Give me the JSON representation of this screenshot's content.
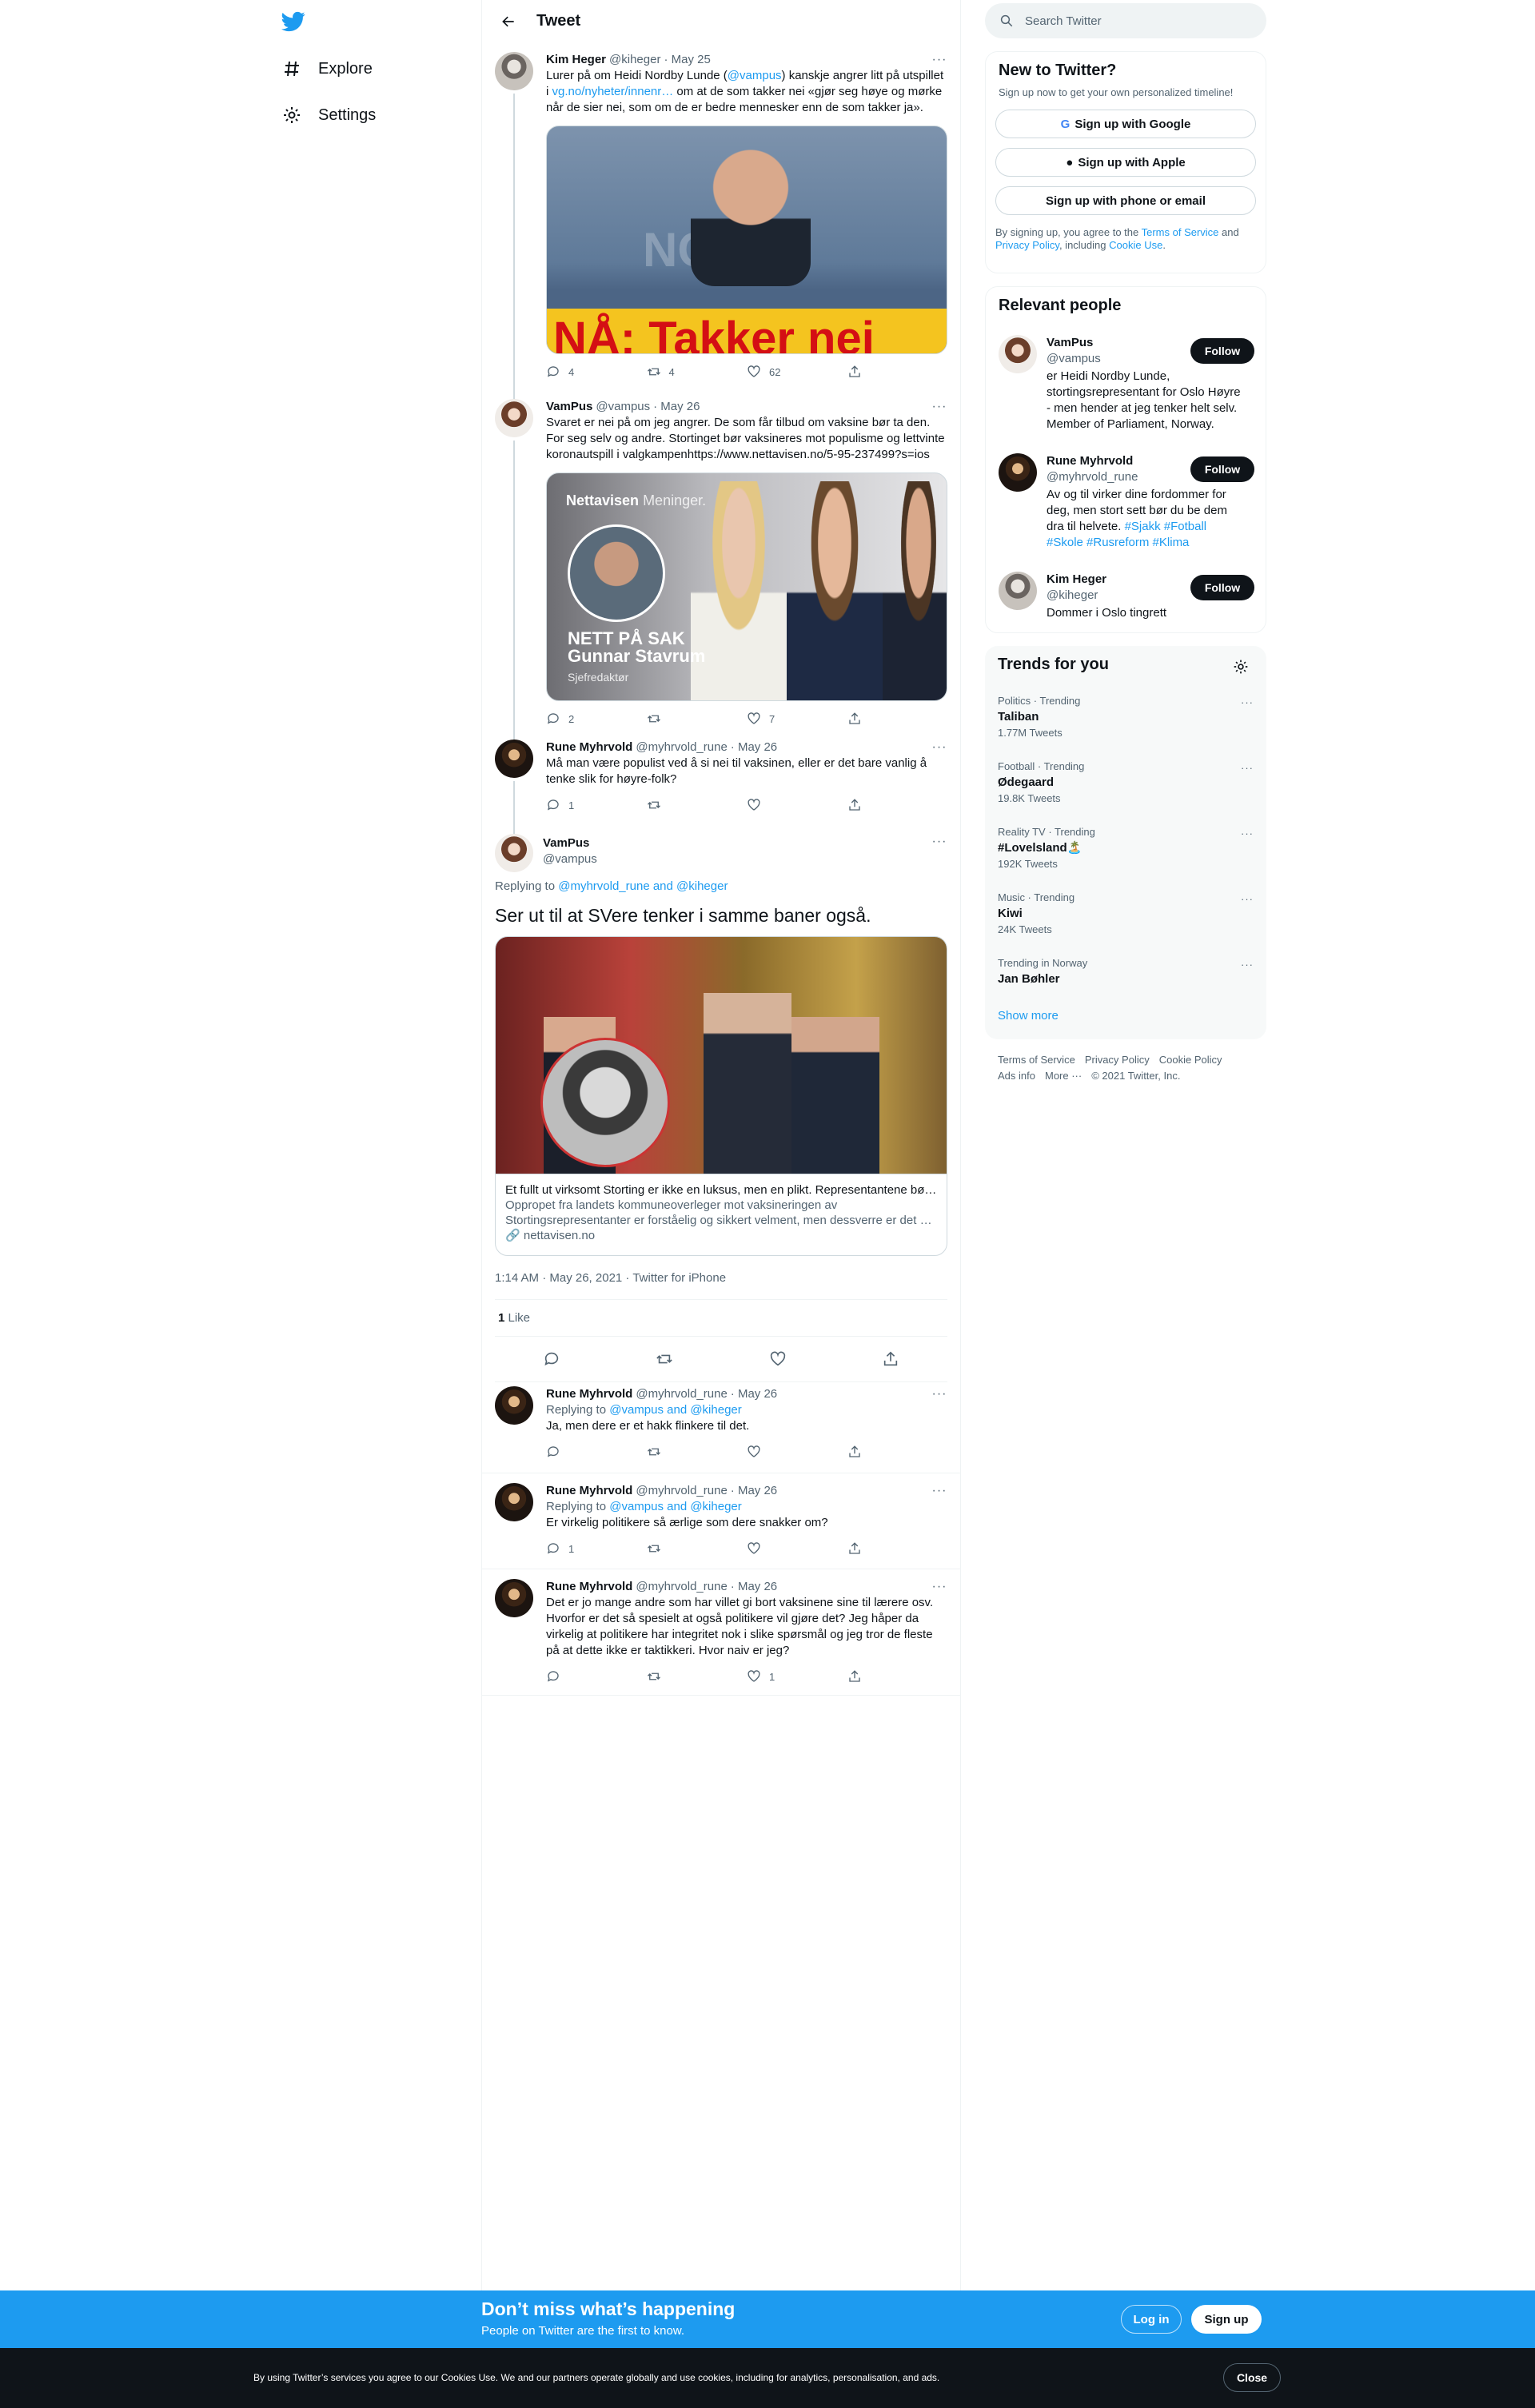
{
  "nav": {
    "explore": "Explore",
    "settings": "Settings"
  },
  "header": {
    "title": "Tweet"
  },
  "tweets": [
    {
      "name": "Kim Heger",
      "handle": "@kiheger",
      "date": "· May 25",
      "t1": "Lurer på om Heidi Nordby Lunde (",
      "mention": "@vampus",
      "t2": ") kanskje angrer litt på utspillet i ",
      "link": "vg.no/nyheter/innenr…",
      "t3": " om at de som takker nei «gjør seg høye og mørke når de sier nei, som om de er bedre mennesker enn de som takker ja».",
      "image_caption": "NÅ: Takker nei",
      "image_bg_text": "NO",
      "replies": "4",
      "retweets": "4",
      "likes": "62"
    },
    {
      "name": "VamPus",
      "handle": "@vampus",
      "date": "· May 26",
      "text": "Svaret er nei på om jeg angrer. De som får tilbud om vaksine bør ta den. For seg selv og andre. Stortinget bør vaksineres mot populisme og lettvinte koronautspill i valgkampenhttps://www.nettavisen.no/5-95-237499?s=ios",
      "card_brand": "Nettavisen",
      "card_brand2": "Meninger.",
      "card_line1": "NETT PÅ SAK",
      "card_line2": "Gunnar Stavrum",
      "card_line3": "Sjefredaktør",
      "replies": "2",
      "retweets": "",
      "likes": "7"
    },
    {
      "name": "Rune Myhrvold",
      "handle": "@myhrvold_rune",
      "date": "· May 26",
      "text": "Må man være populist ved å si nei til vaksinen, eller er det bare vanlig å tenke slik for høyre-folk?",
      "replies": "1",
      "retweets": "",
      "likes": ""
    }
  ],
  "main": {
    "name": "VamPus",
    "handle": "@vampus",
    "replying_prefix": "Replying to ",
    "replying_to": "@myhrvold_rune and @kiheger",
    "text": "Ser ut til at SVere tenker i samme baner også.",
    "card_title": "Et fullt ut virksomt Storting er ikke en luksus, men en plikt. Representantene bør…",
    "card_desc": "Oppropet fra landets kommuneoverleger mot vaksineringen av Stortingsrepresentanter er forståelig og sikkert velment, men dessverre er det …",
    "card_domain": "nettavisen.no",
    "timestamp": "1:14 AM · May 26, 2021 · Twitter for iPhone",
    "likes_count": "1",
    "likes_label": " Like"
  },
  "replies": [
    {
      "name": "Rune Myhrvold",
      "handle": "@myhrvold_rune",
      "date": "· May 26",
      "replying_prefix": "Replying to ",
      "replying_to": "@vampus and @kiheger",
      "text": "Ja, men dere er et hakk flinkere til det.",
      "replies": "",
      "likes": ""
    },
    {
      "name": "Rune Myhrvold",
      "handle": "@myhrvold_rune",
      "date": "· May 26",
      "replying_prefix": "Replying to ",
      "replying_to": "@vampus and @kiheger",
      "text": "Er virkelig politikere så ærlige som dere snakker om?",
      "replies": "1",
      "likes": ""
    },
    {
      "name": "Rune Myhrvold",
      "handle": "@myhrvold_rune",
      "date": "· May 26",
      "text": "Det er jo mange andre som har villet gi bort vaksinene sine til lærere osv. Hvorfor er det så spesielt at også politikere vil gjøre det? Jeg håper da virkelig at politikere har integritet nok i slike spørsmål og jeg tror de fleste på at dette ikke er taktikkeri. Hvor naiv er jeg?",
      "replies": "",
      "likes": "1"
    }
  ],
  "search": {
    "placeholder": "Search Twitter"
  },
  "new_to_twitter": {
    "title": "New to Twitter?",
    "subtitle": "Sign up now to get your own personalized timeline!",
    "google": "Sign up with Google",
    "apple": "Sign up with Apple",
    "phone": "Sign up with phone or email",
    "legal1": "By signing up, you agree to the ",
    "tos": "Terms of Service",
    "legal2": " and ",
    "privacy": "Privacy Policy",
    "legal3": ", including ",
    "cookie": "Cookie Use",
    "legal4": "."
  },
  "relevant": {
    "title": "Relevant people",
    "people": [
      {
        "name": "VamPus",
        "handle": "@vampus",
        "bio": "er Heidi Nordby Lunde, stortingsrepresentant for Oslo Høyre - men hender at jeg tenker helt selv. Member of Parliament, Norway.",
        "follow": "Follow"
      },
      {
        "name": "Rune Myhrvold",
        "handle": "@myhrvold_rune",
        "bio": "Av og til virker dine fordommer for deg, men stort sett bør du be dem dra til helvete. ",
        "tags": "#Sjakk #Fotball #Skole #Rusreform #Klima",
        "follow": "Follow"
      },
      {
        "name": "Kim Heger",
        "handle": "@kiheger",
        "bio": "Dommer i Oslo tingrett",
        "follow": "Follow"
      }
    ]
  },
  "trends": {
    "title": "Trends for you",
    "items": [
      {
        "meta": "Politics · Trending",
        "name": "Taliban",
        "count": "1.77M Tweets"
      },
      {
        "meta": "Football · Trending",
        "name": "Ødegaard",
        "count": "19.8K Tweets"
      },
      {
        "meta": "Reality TV · Trending",
        "name": "#Lovelsland🏝️",
        "count": "192K Tweets"
      },
      {
        "meta": "Music · Trending",
        "name": "Kiwi",
        "count": "24K Tweets"
      },
      {
        "meta": "Trending in Norway",
        "name": "Jan Bøhler",
        "count": ""
      }
    ],
    "show_more": "Show more"
  },
  "footer": {
    "tos": "Terms of Service",
    "privacy": "Privacy Policy",
    "cookie": "Cookie Policy",
    "ads": "Ads info",
    "more": "More ···",
    "copy": "© 2021 Twitter, Inc."
  },
  "bottom_bar": {
    "title": "Don’t miss what’s happening",
    "subtitle": "People on Twitter are the first to know.",
    "login": "Log in",
    "signup": "Sign up"
  },
  "cookie_bar": {
    "text": "By using Twitter’s services you agree to our Cookies Use. We and our partners operate globally and use cookies, including for analytics, personalisation, and ads.",
    "close": "Close"
  },
  "colors": {
    "accent": "#1d9bf0",
    "text": "#0f1419",
    "muted": "#536471"
  }
}
